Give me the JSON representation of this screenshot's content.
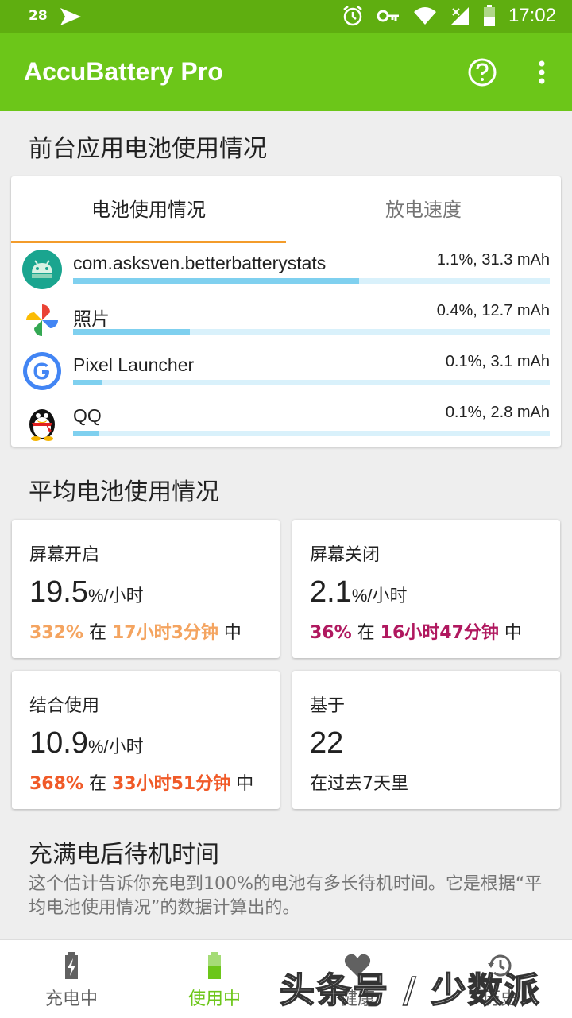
{
  "status_bar": {
    "notification_count": "28",
    "time": "17:02"
  },
  "app_bar": {
    "title": "AccuBattery Pro"
  },
  "foreground_section": {
    "title": "前台应用电池使用情况",
    "tabs": [
      {
        "label": "电池使用情况",
        "active": true
      },
      {
        "label": "放电速度",
        "active": false
      }
    ],
    "apps": [
      {
        "name": "com.asksven.betterbatterystats",
        "value": "1.1%, 31.3 mAh",
        "icon": "android-icon",
        "fill": 0.6
      },
      {
        "name": "照片",
        "value": "0.4%, 12.7 mAh",
        "icon": "photos-icon",
        "fill": 0.245
      },
      {
        "name": "Pixel Launcher",
        "value": "0.1%, 3.1 mAh",
        "icon": "google-icon",
        "fill": 0.06
      },
      {
        "name": "QQ",
        "value": "0.1%, 2.8 mAh",
        "icon": "qq-penguin-icon",
        "fill": 0.053
      }
    ]
  },
  "average_section": {
    "title": "平均电池使用情况",
    "cards": [
      {
        "label": "屏幕开启",
        "value": "19.5",
        "unit": "%/小时",
        "pct": "332%",
        "mid": " 在 ",
        "duration": "17小时3分钟",
        "end": " 中",
        "color": "#f4a460"
      },
      {
        "label": "屏幕关闭",
        "value": "2.1",
        "unit": "%/小时",
        "pct": "36%",
        "mid": " 在 ",
        "duration": "16小时47分钟",
        "end": " 中",
        "color": "#b0185f"
      },
      {
        "label": "结合使用",
        "value": "10.9",
        "unit": "%/小时",
        "pct": "368%",
        "mid": " 在 ",
        "duration": "33小时51分钟",
        "end": " 中",
        "color": "#f05a28"
      },
      {
        "label": "基于",
        "value": "22",
        "sub": "在过去7天里"
      }
    ]
  },
  "standby_section": {
    "title": "充满电后待机时间",
    "description": "这个估计告诉你充电到100%的电池有多长待机时间。它是根据“平均电池使用情况”的数据计算出的。"
  },
  "bottom_nav": {
    "items": [
      {
        "label": "充电中",
        "icon": "battery-charging-icon",
        "active": false
      },
      {
        "label": "使用中",
        "icon": "battery-icon",
        "active": true
      },
      {
        "label": "健康",
        "icon": "heart-icon",
        "active": false
      },
      {
        "label": "历史",
        "icon": "history-icon",
        "active": false
      }
    ]
  },
  "watermark": "头条号 / 少数派",
  "colors": {
    "status_bar": "#5fae10",
    "app_bar": "#6cc619",
    "tab_indicator": "#f39c2b",
    "bar_fill": "#7fd0ef",
    "bar_track": "#d9f1fb"
  }
}
